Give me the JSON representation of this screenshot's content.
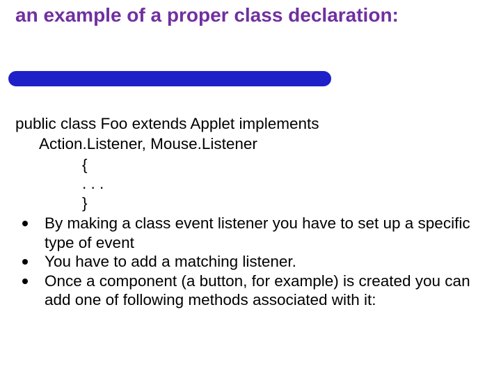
{
  "title": "an example of a proper class declaration:",
  "code": {
    "line1": "public class Foo extends Applet implements",
    "line2": "Action.Listener, Mouse.Listener",
    "brace_open": "{",
    "ellipsis": ". . .",
    "brace_close": "}"
  },
  "bullets": [
    "By making a class event listener you have to set up a specific type of event",
    "You have to add a matching listener.",
    "Once a component (a button, for example) is created you can add one of following methods associated with it:"
  ],
  "colors": {
    "title": "#7030a0",
    "rule": "#2020c8"
  }
}
